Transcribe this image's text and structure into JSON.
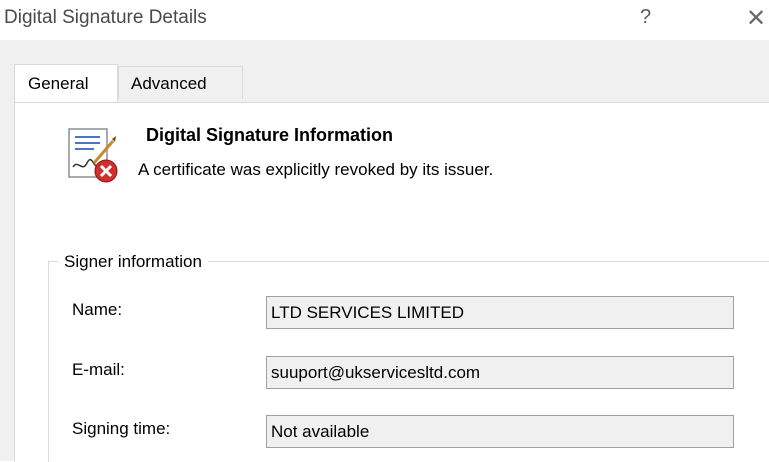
{
  "window": {
    "title": "Digital Signature Details",
    "help_glyph": "?",
    "close_glyph": "✕"
  },
  "tabs": [
    {
      "label": "General",
      "active": true
    },
    {
      "label": "Advanced",
      "active": false
    }
  ],
  "info": {
    "icon": "revoked-certificate-icon",
    "title": "Digital Signature Information",
    "message": "A certificate was explicitly revoked by its issuer."
  },
  "signer": {
    "group_label": "Signer information",
    "fields": [
      {
        "label": "Name:",
        "value": "LTD SERVICES LIMITED"
      },
      {
        "label": "E-mail:",
        "value": "suuport@ukservicesltd.com"
      },
      {
        "label": "Signing time:",
        "value": "Not available"
      }
    ]
  }
}
